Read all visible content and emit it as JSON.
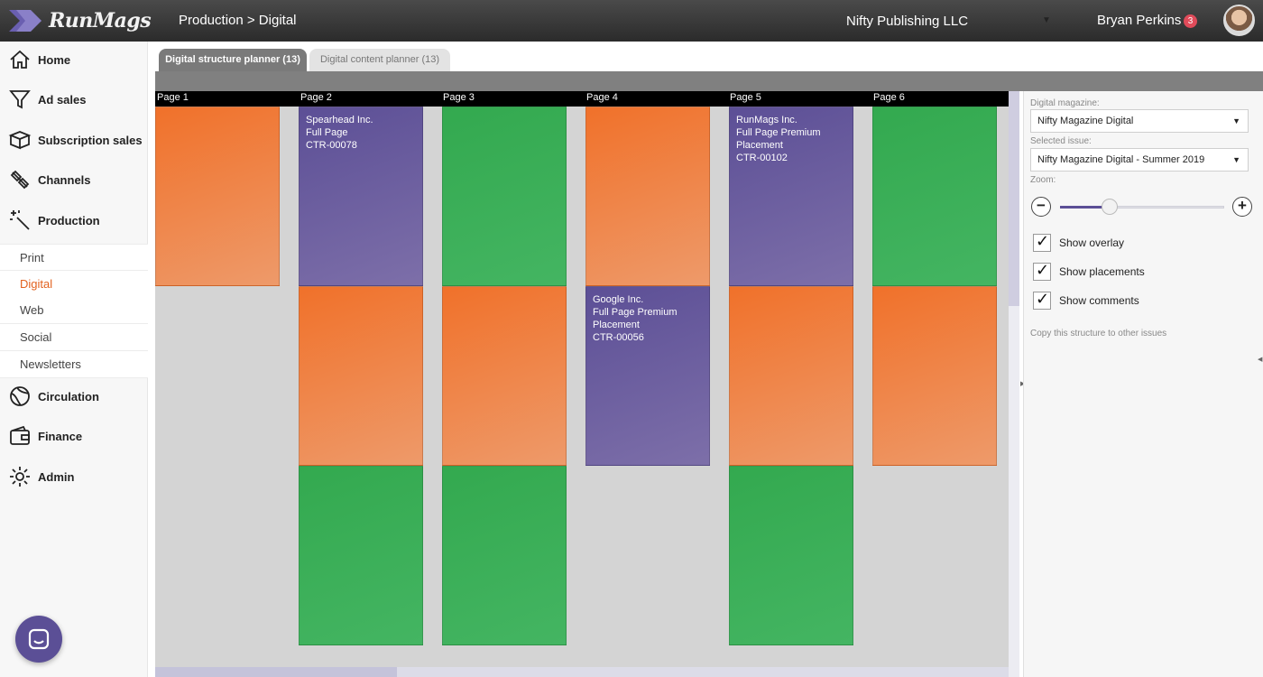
{
  "app": {
    "name": "RunMags"
  },
  "header": {
    "breadcrumb": "Production > Digital",
    "company": "Nifty Publishing LLC",
    "user_name": "Bryan Perkins",
    "notification_count": "3"
  },
  "sidebar": {
    "items": [
      {
        "label": "Home",
        "icon": "home-icon"
      },
      {
        "label": "Ad sales",
        "icon": "funnel-icon"
      },
      {
        "label": "Subscription sales",
        "icon": "box-icon"
      },
      {
        "label": "Channels",
        "icon": "satellite-icon"
      },
      {
        "label": "Production",
        "icon": "magic-wand-icon"
      },
      {
        "label": "Circulation",
        "icon": "globe-icon"
      },
      {
        "label": "Finance",
        "icon": "wallet-icon"
      },
      {
        "label": "Admin",
        "icon": "gear-icon"
      }
    ],
    "production_subitems": [
      {
        "label": "Print",
        "active": false
      },
      {
        "label": "Digital",
        "active": true
      },
      {
        "label": "Web",
        "active": false
      },
      {
        "label": "Social",
        "active": false
      },
      {
        "label": "Newsletters",
        "active": false
      }
    ]
  },
  "tabs": [
    {
      "label": "Digital structure planner (13)",
      "active": true
    },
    {
      "label": "Digital content planner (13)",
      "active": false
    }
  ],
  "planner": {
    "pages": [
      "Page 1",
      "Page 2",
      "Page 3",
      "Page 4",
      "Page 5",
      "Page 6"
    ],
    "blocks": {
      "spearhead": {
        "line1": "Spearhead Inc.",
        "line2": "Full Page",
        "line3": "CTR-00078"
      },
      "google": {
        "line1": "Google Inc.",
        "line2": "Full Page Premium",
        "line3": "Placement",
        "line4": "CTR-00056"
      },
      "runmags": {
        "line1": "RunMags Inc.",
        "line2": "Full Page Premium",
        "line3": "Placement",
        "line4": "CTR-00102"
      }
    }
  },
  "panel": {
    "magazine_label": "Digital magazine:",
    "magazine_value": "Nifty Magazine Digital",
    "issue_label": "Selected issue:",
    "issue_value": "Nifty Magazine Digital - Summer 2019",
    "zoom_label": "Zoom:",
    "zoom_level": 0.3,
    "checks": [
      {
        "label": "Show overlay",
        "checked": true
      },
      {
        "label": "Show placements",
        "checked": true
      },
      {
        "label": "Show comments",
        "checked": true
      }
    ],
    "copy_link": "Copy this structure to other issues"
  },
  "colors": {
    "orange": "#f0712a",
    "green": "#33a94f",
    "purple": "#5c4f96",
    "active_nav": "#e2621f"
  }
}
